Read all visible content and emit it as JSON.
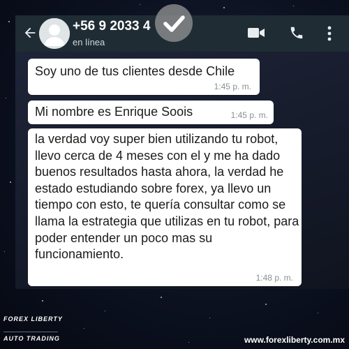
{
  "chat": {
    "contact_name": "+56 9 2033 4",
    "status": "en línea",
    "icons": [
      "back-arrow-icon",
      "avatar-icon",
      "checkmark-icon",
      "video-call-icon",
      "phone-icon",
      "more-vert-icon"
    ]
  },
  "messages": [
    {
      "text": "Soy uno de tus clientes desde Chile",
      "time": "1:45 p. m."
    },
    {
      "text": "Mi nombre es Enrique Soois",
      "time": "1:45 p. m."
    },
    {
      "text": "la verdad voy super bien utilizando tu robot, llevo cerca de 4 meses con el y me ha dado buenos resultados hasta ahora, la verdad he estado estudiando sobre forex, ya llevo un tiempo con esto, te quería consultar como se llama la estrategia que utilizas en tu robot, para poder entender un poco mas su funcionamiento.",
      "time": "1:48 p. m."
    }
  ],
  "branding": {
    "line1": "FOREX LIBERTY",
    "line2": "AUTO TRADING",
    "website": "www.forexliberty.com.mx"
  },
  "colors": {
    "header": "#1f2c34",
    "bubble": "#ffffff",
    "background": "#0c1120"
  }
}
